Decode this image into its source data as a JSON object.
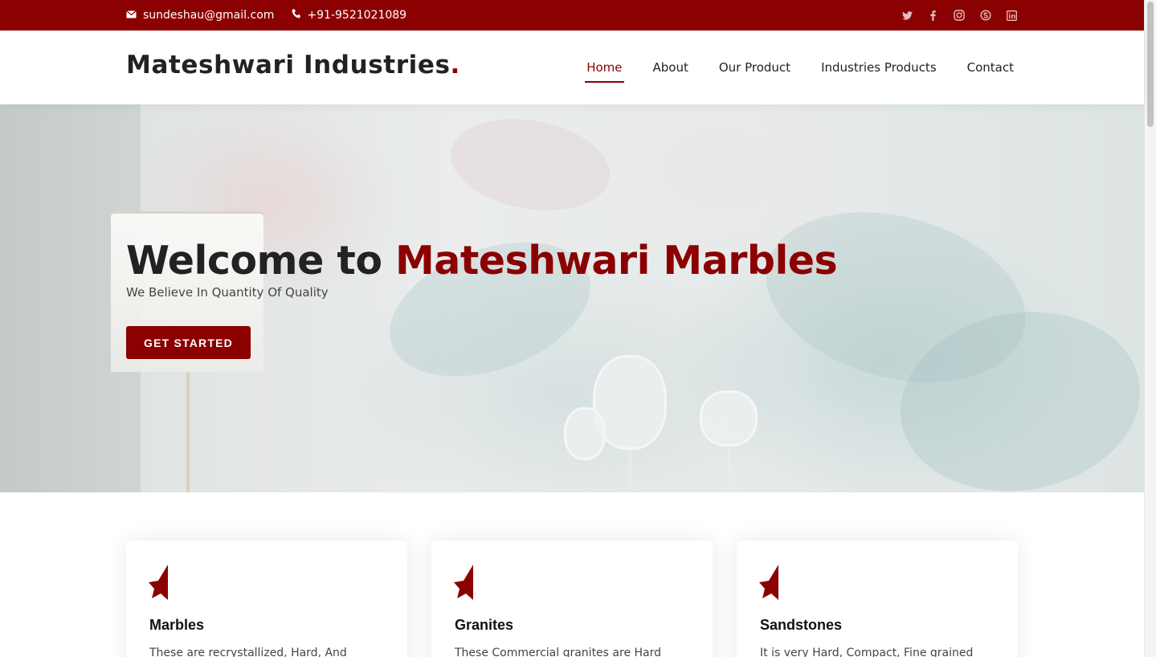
{
  "topbar": {
    "email": "sundeshau@gmail.com",
    "phone": "+91-9521021089",
    "social": [
      "twitter-icon",
      "facebook-icon",
      "instagram-icon",
      "skype-icon",
      "linkedin-icon"
    ]
  },
  "header": {
    "logo": "Mateshwari Industries",
    "logo_dot": ".",
    "nav": [
      "Home",
      "About",
      "Our Product",
      "Industries Products",
      "Contact"
    ],
    "active": "Home"
  },
  "hero": {
    "title_prefix": "Welcome to ",
    "title_accent": "Mateshwari Marbles",
    "subtitle": "We Believe In Quantity Of Quality",
    "cta": "GET STARTED"
  },
  "cards": [
    {
      "title": "Marbles",
      "text": "These are recrystallized, Hard, And"
    },
    {
      "title": "Granites",
      "text": "These Commercial granites are Hard"
    },
    {
      "title": "Sandstones",
      "text": "It is very Hard, Compact, Fine grained"
    }
  ],
  "colors": {
    "brand": "#8b0000",
    "text": "#222222"
  }
}
